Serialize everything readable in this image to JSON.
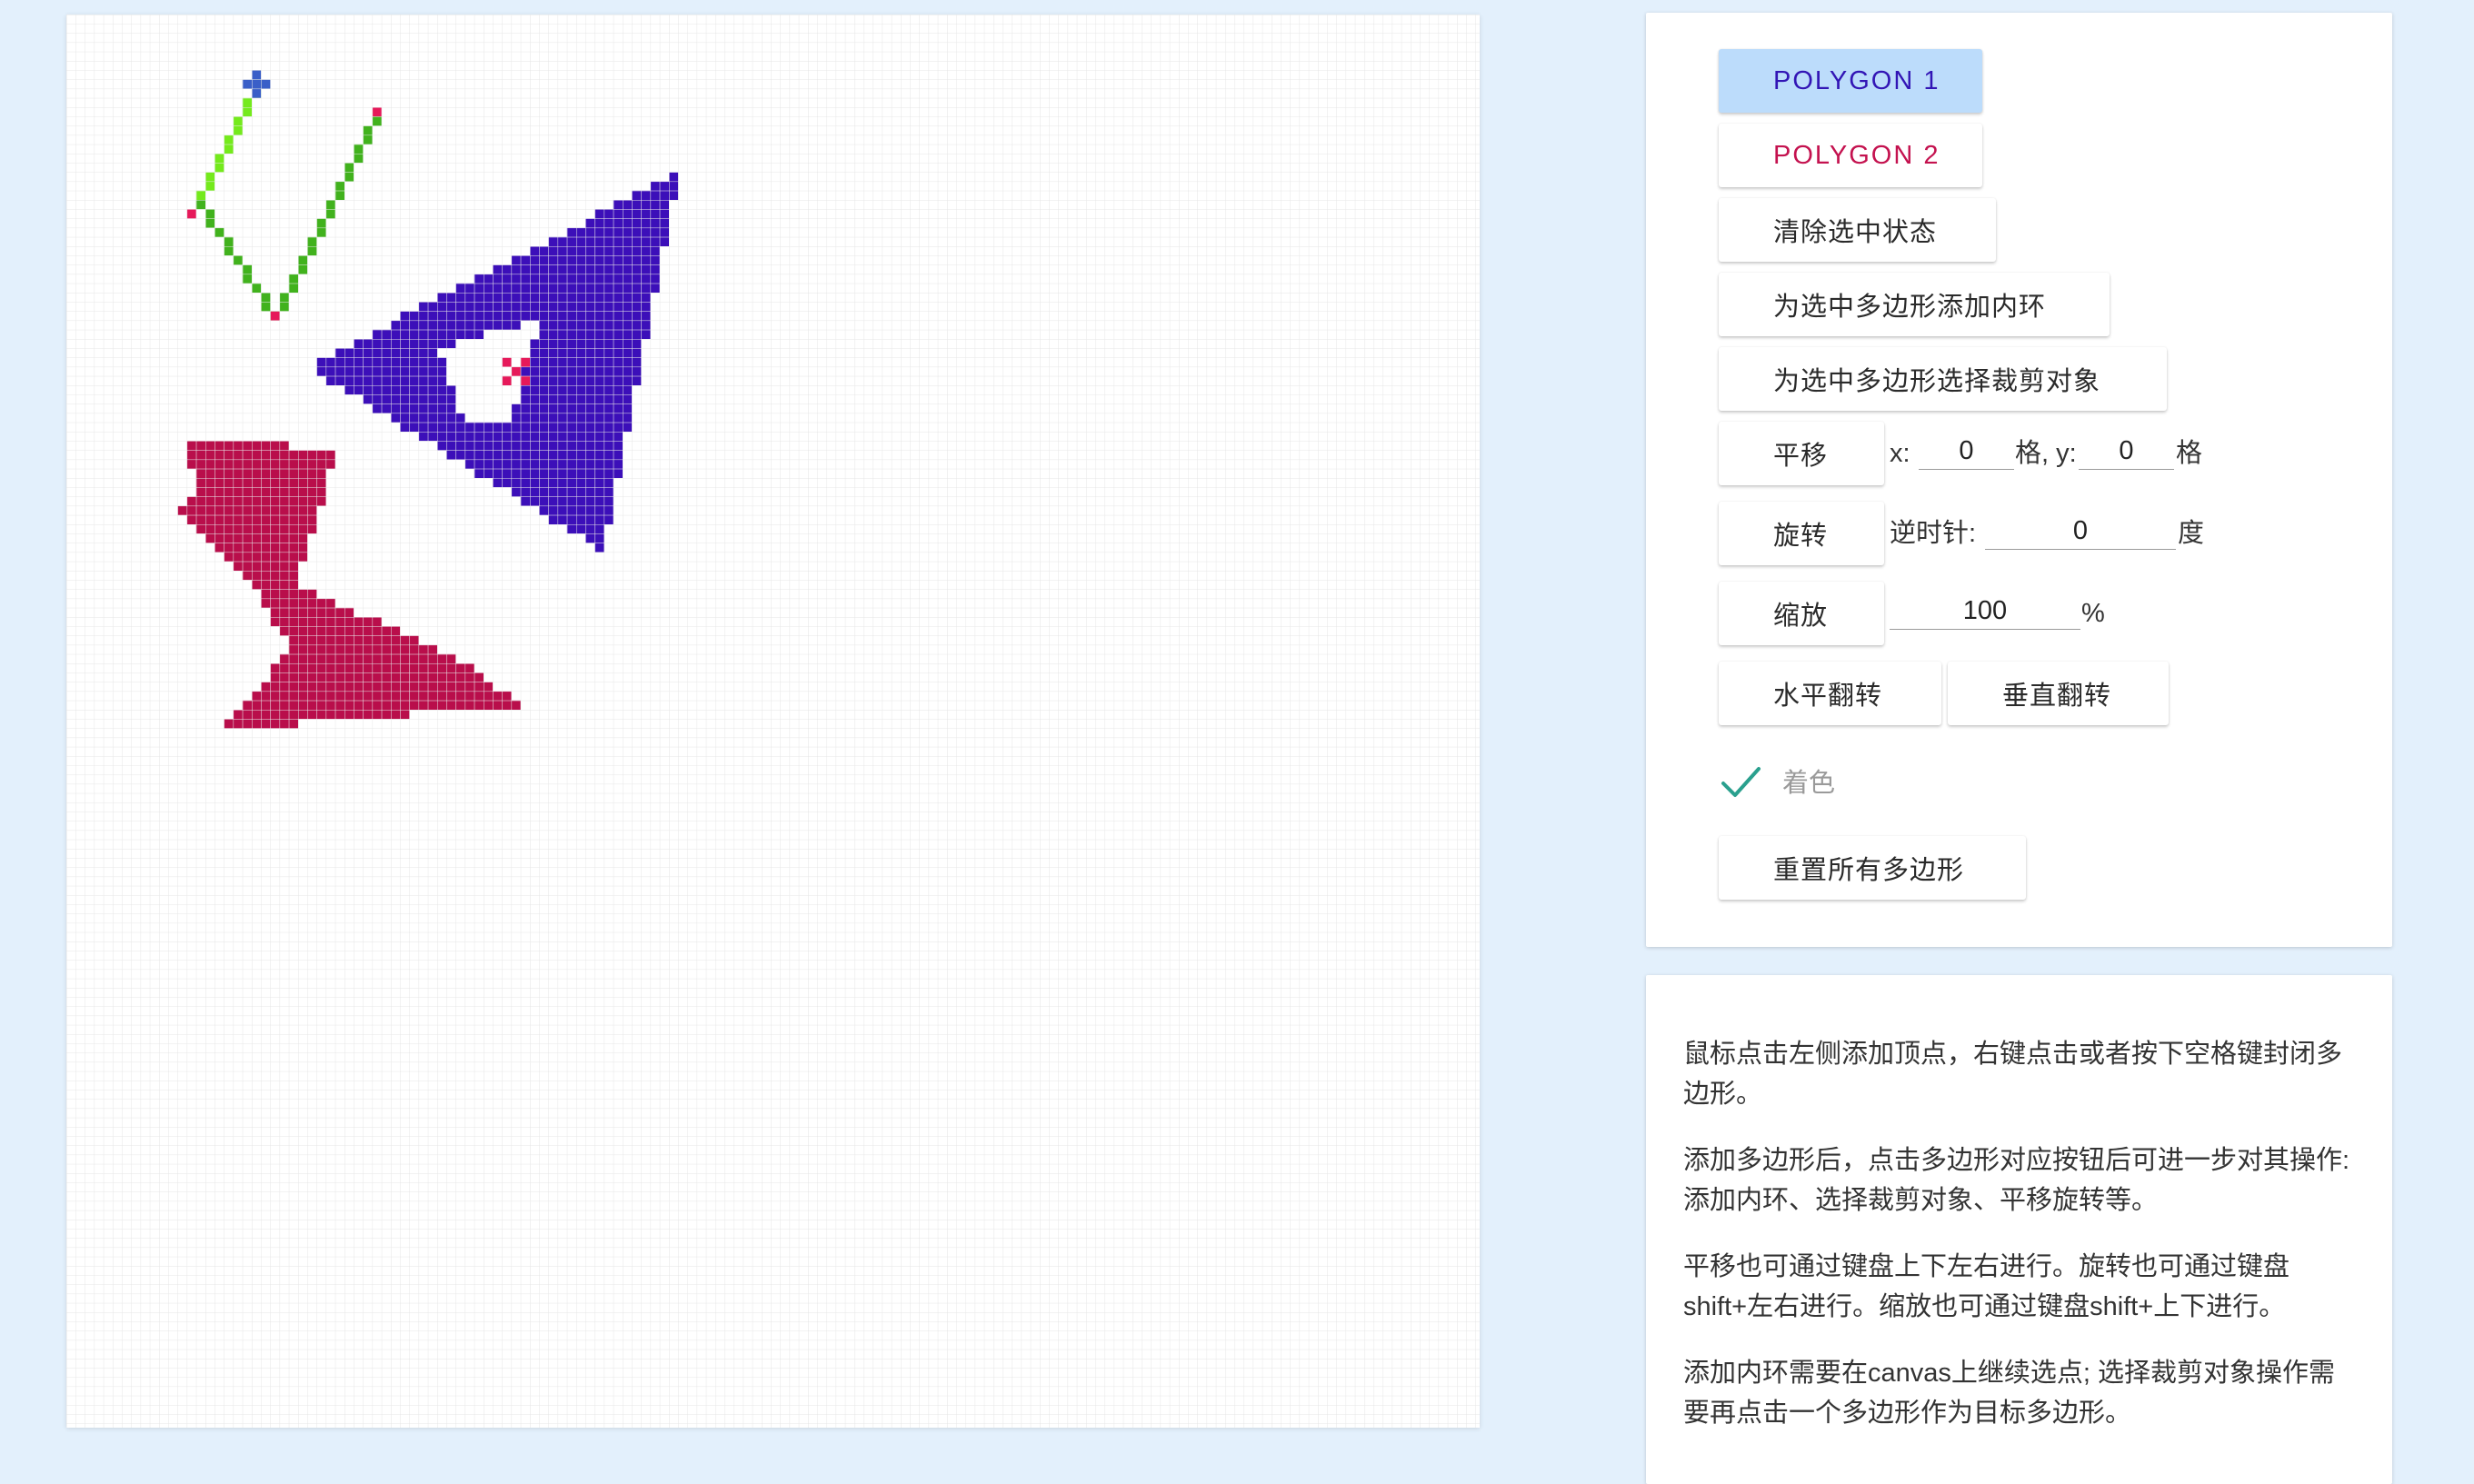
{
  "colors": {
    "page_bg": "#e3f0fc",
    "grid_line": "#e6e6e6",
    "polygon1_fill": "#3c0fb9",
    "polygon2_fill": "#b90e4b",
    "polyline_light": "#74ea1c",
    "polyline_dark": "#41b21d",
    "marker_pink": "#e6195a",
    "marker_blue": "#3a5fc8",
    "check_teal": "#2aa08e"
  },
  "controls": {
    "polygon1_label": "POLYGON 1",
    "polygon2_label": "POLYGON 2",
    "clear_selection_label": "清除选中状态",
    "add_inner_ring_label": "为选中多边形添加内环",
    "select_clip_target_label": "为选中多边形选择裁剪对象",
    "translate": {
      "button_label": "平移",
      "x_label": "x:",
      "x_value": "0",
      "x_unit": "格, y:",
      "y_value": "0",
      "y_unit": "格"
    },
    "rotate": {
      "button_label": "旋转",
      "direction_label": "逆时针:",
      "value": "0",
      "unit": "度"
    },
    "scale": {
      "button_label": "缩放",
      "value": "100",
      "unit": "%"
    },
    "flip_horizontal_label": "水平翻转",
    "flip_vertical_label": "垂直翻转",
    "fill_toggle": {
      "label": "着色",
      "checked": true,
      "icon": "check-icon"
    },
    "reset_all_label": "重置所有多边形"
  },
  "help": {
    "paragraphs": [
      "鼠标点击左侧添加顶点，右键点击或者按下空格键封闭多边形。",
      "添加多边形后，点击多边形对应按钮后可进一步对其操作: 添加内环、选择裁剪对象、平移旋转等。",
      "平移也可通过键盘上下左右进行。旋转也可通过键盘shift+左右进行。缩放也可通过键盘shift+上下进行。",
      "添加内环需要在canvas上继续选点; 选择裁剪对象操作需要再点击一个多边形作为目标多边形。"
    ]
  }
}
